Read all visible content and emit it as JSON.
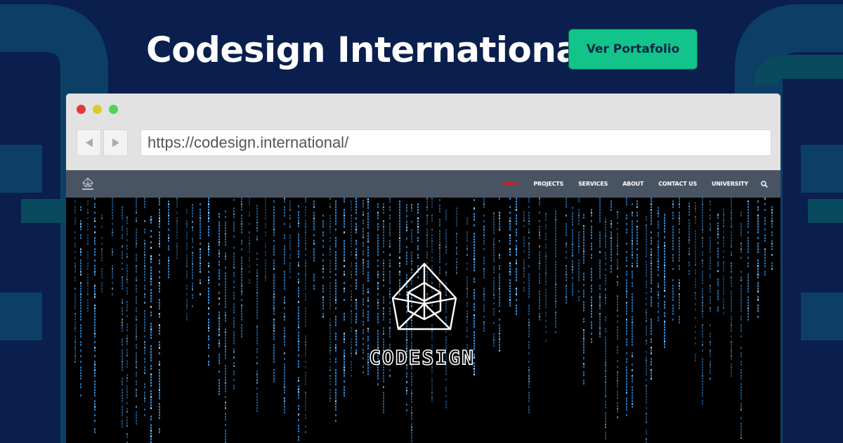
{
  "page": {
    "title": "Codesign International",
    "cta_label": "Ver Portafolio",
    "colors": {
      "background": "#0a1f4e",
      "cta": "#12c48a",
      "cta_text": "#0b2547"
    }
  },
  "browser": {
    "url": "https://codesign.international/",
    "traffic_lights": [
      "#e0393a",
      "#dcca2a",
      "#4fd359"
    ],
    "back_icon": "back-arrow-icon",
    "forward_icon": "forward-arrow-icon"
  },
  "site": {
    "nav": [
      {
        "label": "HOME",
        "active": true
      },
      {
        "label": "PROJECTS",
        "active": false
      },
      {
        "label": "SERVICES",
        "active": false
      },
      {
        "label": "ABOUT",
        "active": false
      },
      {
        "label": "CONTACT US",
        "active": false
      },
      {
        "label": "UNIVERSITY",
        "active": false
      }
    ],
    "search_icon": "search-icon",
    "hero_wordmark": "CODESIGN",
    "hero_background": "matrix-digital-rain"
  }
}
